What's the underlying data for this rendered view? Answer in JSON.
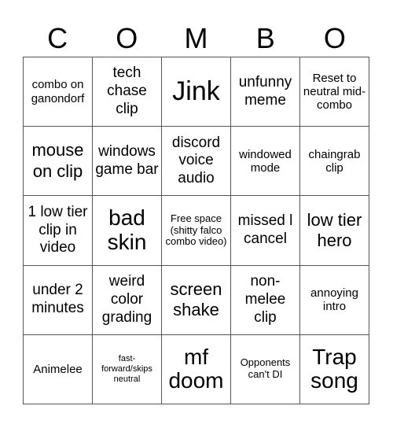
{
  "title_letters": [
    "C",
    "O",
    "M",
    "B",
    "O"
  ],
  "cells": [
    {
      "text": "combo on ganondorf",
      "size": "s2"
    },
    {
      "text": "tech chase clip",
      "size": "s3"
    },
    {
      "text": "Jink",
      "size": "s6"
    },
    {
      "text": "unfunny meme",
      "size": "s3"
    },
    {
      "text": "Reset to neutral mid-combo",
      "size": "s2"
    },
    {
      "text": "mouse on clip",
      "size": "s4"
    },
    {
      "text": "windows game bar",
      "size": "s3"
    },
    {
      "text": "discord voice audio",
      "size": "s3"
    },
    {
      "text": "windowed mode",
      "size": "s2"
    },
    {
      "text": "chaingrab clip",
      "size": "s2"
    },
    {
      "text": "1 low tier clip in video",
      "size": "s3"
    },
    {
      "text": "bad skin",
      "size": "s5"
    },
    {
      "text": "Free space (shitty falco combo video)",
      "size": "s1"
    },
    {
      "text": "missed l cancel",
      "size": "s3"
    },
    {
      "text": "low tier hero",
      "size": "s4"
    },
    {
      "text": "under 2 minutes",
      "size": "s3"
    },
    {
      "text": "weird color grading",
      "size": "s3"
    },
    {
      "text": "screen shake",
      "size": "s4"
    },
    {
      "text": "non-melee clip",
      "size": "s3"
    },
    {
      "text": "annoying intro",
      "size": "s2"
    },
    {
      "text": "Animelee",
      "size": "s2"
    },
    {
      "text": "fast-forward/skips neutral",
      "size": "s0"
    },
    {
      "text": "mf doom",
      "size": "s5"
    },
    {
      "text": "Opponents can't DI",
      "size": "s1"
    },
    {
      "text": "Trap song",
      "size": "s5"
    }
  ]
}
